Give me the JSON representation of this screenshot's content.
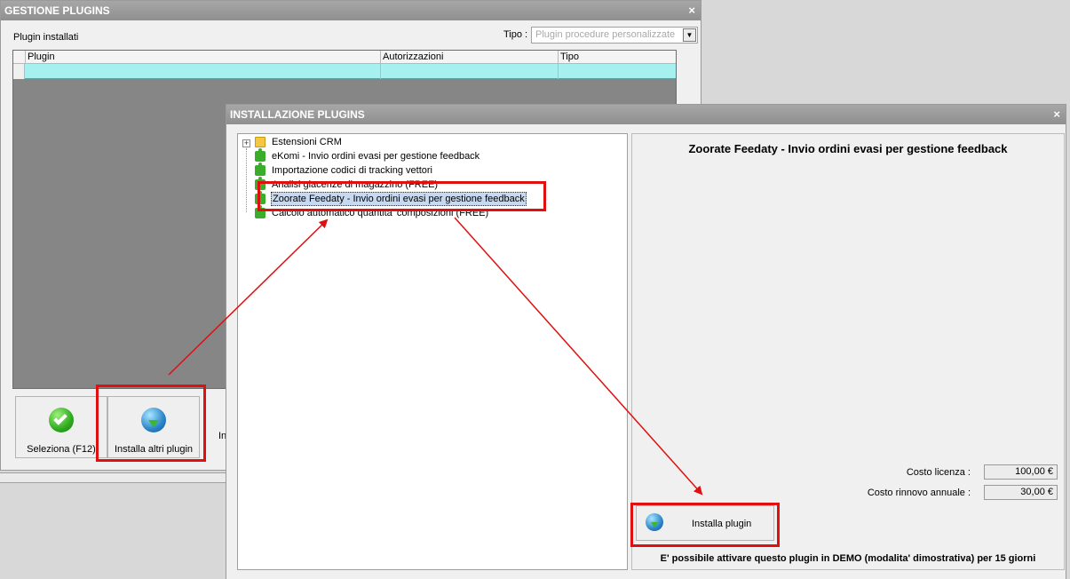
{
  "back_window": {
    "title": "GESTIONE PLUGINS",
    "close_glyph": "×",
    "installed_label": "Plugin installati",
    "tipo_label": "Tipo :",
    "tipo_placeholder": "Plugin procedure personalizzate",
    "columns": [
      "Plugin",
      "Autorizzazioni",
      "Tipo"
    ],
    "buttons": {
      "seleziona": "Seleziona (F12)",
      "installa_altri": "Installa altri plugin"
    },
    "truncated_text": "In"
  },
  "front_window": {
    "title": "INSTALLAZIONE PLUGINS",
    "close_glyph": "×",
    "tree": {
      "root": "Estensioni CRM",
      "items": [
        "eKomi - Invio ordini evasi per gestione feedback",
        "Importazione codici di tracking vettori",
        "Analisi giacenze di magazzino (FREE)",
        "Zoorate Feedaty - Invio ordini evasi per gestione feedback",
        "Calcolo automatico quantita' composizioni (FREE)"
      ],
      "selected_index": 3
    },
    "detail": {
      "title": "Zoorate Feedaty - Invio ordini evasi per gestione feedback",
      "costo_licenza_label": "Costo licenza :",
      "costo_licenza_value": "100,00 €",
      "costo_rinnovo_label": "Costo rinnovo annuale :",
      "costo_rinnovo_value": "30,00 €",
      "install_button": "Installa plugin",
      "demo_note": "E' possibile attivare questo plugin in DEMO (modalita' dimostrativa) per 15 giorni"
    }
  },
  "colors": {
    "annotation_red": "#e01010",
    "grid_row": "#a6f1f0",
    "titlebar": "#9a9a9a"
  }
}
